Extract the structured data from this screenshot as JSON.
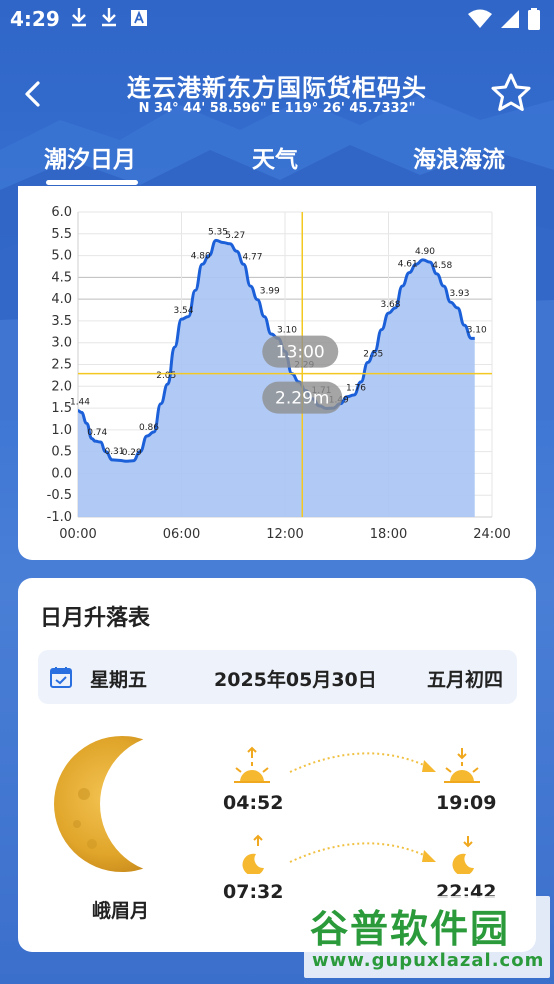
{
  "status": {
    "time": "4:29",
    "icons": [
      "download-icon",
      "download-icon",
      "font-icon",
      "wifi-icon",
      "signal-icon",
      "battery-icon"
    ]
  },
  "header": {
    "title": "连云港新东方国际货柜码头",
    "coords": "N 34° 44' 58.596\"   E 119° 26' 45.7332\""
  },
  "tabs": [
    {
      "label": "潮汐日月",
      "active": true
    },
    {
      "label": "天气",
      "active": false
    },
    {
      "label": "海浪海流",
      "active": false
    }
  ],
  "chart_data": {
    "type": "area",
    "x_ticks": [
      "00:00",
      "06:00",
      "12:00",
      "18:00",
      "24:00"
    ],
    "y_ticks": [
      "6.0",
      "5.5",
      "5.0",
      "4.5",
      "4.0",
      "3.5",
      "3.0",
      "2.5",
      "2.0",
      "1.5",
      "1.0",
      "0.5",
      "0.0",
      "-0.5",
      "-1.0"
    ],
    "ylim": [
      -1.0,
      6.0
    ],
    "xlim": [
      0,
      24
    ],
    "series": [
      {
        "x": [
          0,
          0.2,
          0.5,
          0.8,
          1.0,
          1.3,
          1.6,
          2.0,
          2.4,
          2.8,
          3.2,
          3.6,
          4.0,
          4.4,
          4.8,
          5.2,
          5.6,
          6.0,
          6.4,
          6.8,
          7.2,
          7.6,
          8.0,
          8.4,
          8.8,
          9.2,
          9.6,
          10.0,
          10.4,
          10.8,
          11.2,
          11.6,
          12.0,
          12.4,
          12.8,
          13.2,
          13.6,
          14.0,
          14.4,
          14.8,
          15.2,
          15.6,
          16.0,
          16.4,
          16.8,
          17.2,
          17.6,
          18.0,
          18.4,
          18.8,
          19.2,
          19.6,
          20.0,
          20.4,
          20.8,
          21.2,
          21.6,
          22.0,
          22.4,
          22.8,
          23.0
        ],
        "y": [
          1.44,
          1.4,
          1.15,
          0.8,
          0.74,
          0.72,
          0.5,
          0.31,
          0.3,
          0.28,
          0.29,
          0.5,
          0.86,
          0.95,
          1.6,
          2.05,
          2.9,
          3.54,
          3.6,
          4.2,
          4.8,
          5.0,
          5.35,
          5.3,
          5.27,
          5.1,
          4.8,
          4.3,
          3.99,
          3.6,
          3.2,
          3.1,
          2.8,
          2.29,
          2.1,
          1.9,
          1.71,
          1.55,
          1.49,
          1.5,
          1.6,
          1.76,
          1.8,
          2.1,
          2.55,
          2.8,
          3.3,
          3.68,
          3.8,
          4.3,
          4.61,
          4.8,
          4.9,
          4.85,
          4.58,
          4.3,
          3.93,
          3.8,
          3.4,
          3.1,
          3.1
        ]
      }
    ],
    "point_labels": [
      {
        "x": 0.0,
        "y": 1.44,
        "text": "1.44"
      },
      {
        "x": 1.0,
        "y": 0.74,
        "text": "0.74"
      },
      {
        "x": 2.0,
        "y": 0.31,
        "text": "0.31"
      },
      {
        "x": 3.0,
        "y": 0.29,
        "text": "0.29"
      },
      {
        "x": 4.0,
        "y": 0.86,
        "text": "0.86"
      },
      {
        "x": 5.0,
        "y": 2.05,
        "text": "2.05"
      },
      {
        "x": 6.0,
        "y": 3.54,
        "text": "3.54"
      },
      {
        "x": 7.0,
        "y": 4.8,
        "text": "4.80"
      },
      {
        "x": 8.0,
        "y": 5.35,
        "text": "5.35"
      },
      {
        "x": 9.0,
        "y": 5.27,
        "text": "5.27"
      },
      {
        "x": 10.0,
        "y": 4.77,
        "text": "4.77"
      },
      {
        "x": 11.0,
        "y": 3.99,
        "text": "3.99"
      },
      {
        "x": 12.0,
        "y": 3.1,
        "text": "3.10"
      },
      {
        "x": 13.0,
        "y": 2.29,
        "text": "2.29"
      },
      {
        "x": 14.0,
        "y": 1.71,
        "text": "1.71"
      },
      {
        "x": 15.0,
        "y": 1.49,
        "text": "1.49"
      },
      {
        "x": 16.0,
        "y": 1.76,
        "text": "1.76"
      },
      {
        "x": 17.0,
        "y": 2.55,
        "text": "2.55"
      },
      {
        "x": 18.0,
        "y": 3.68,
        "text": "3.68"
      },
      {
        "x": 19.0,
        "y": 4.61,
        "text": "4.61"
      },
      {
        "x": 20.0,
        "y": 4.9,
        "text": "4.90"
      },
      {
        "x": 21.0,
        "y": 4.58,
        "text": "4.58"
      },
      {
        "x": 22.0,
        "y": 3.93,
        "text": "3.93"
      },
      {
        "x": 23.0,
        "y": 3.1,
        "text": "3.10"
      }
    ],
    "crosshair": {
      "x": 13.0,
      "y": 2.29,
      "time_label": "13:00",
      "value_label": "2.29m"
    },
    "grid": true,
    "colors": {
      "line": "#1b5fd9",
      "fill": "#a9c4f4",
      "crosshair": "#f3c820"
    }
  },
  "sun_moon": {
    "title": "日月升落表",
    "weekday": "星期五",
    "date": "2025年05月30日",
    "lunar": "五月初四",
    "moon_phase": "峨眉月",
    "sunrise": "04:52",
    "sunset": "19:09",
    "moonrise": "07:32",
    "moonset": "22:42"
  },
  "watermark": {
    "big": "谷普软件园",
    "small": "www.gupuxlazal.com"
  }
}
